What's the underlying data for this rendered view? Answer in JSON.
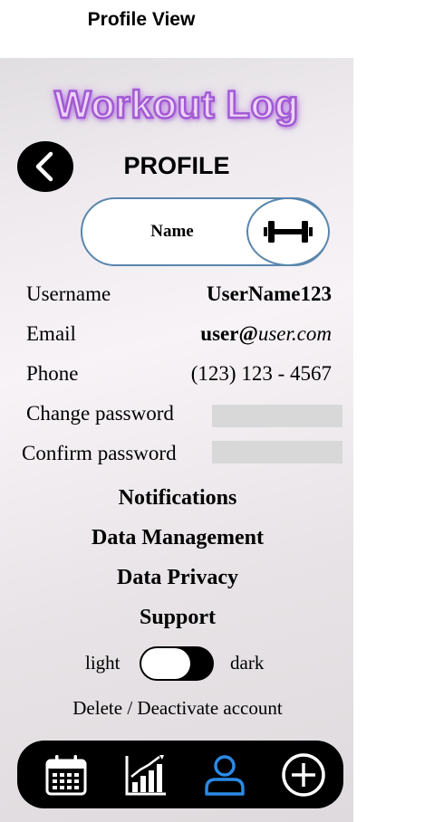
{
  "caption": "Profile View",
  "app": {
    "title": "Workout Log"
  },
  "header": {
    "title": "PROFILE",
    "back_icon": "chevron-left-icon"
  },
  "profile": {
    "name": "Name",
    "avatar_icon": "dumbbell-icon"
  },
  "fields": {
    "username": {
      "label": "Username",
      "value": "UserName123"
    },
    "email": {
      "label": "Email",
      "value_user": "user@",
      "value_domain": "user.com"
    },
    "phone": {
      "label": "Phone",
      "value": "(123) 123 - 4567"
    },
    "change_password": {
      "label": "Change password",
      "value": ""
    },
    "confirm_password": {
      "label": "Confirm password",
      "value": ""
    }
  },
  "menu": {
    "notifications": "Notifications",
    "data_management": "Data Management",
    "data_privacy": "Data Privacy",
    "support": "Support"
  },
  "theme": {
    "light_label": "light",
    "dark_label": "dark",
    "state": "light"
  },
  "account": {
    "delete_label": "Delete / Deactivate account"
  },
  "nav": {
    "items": [
      {
        "icon": "calendar-icon",
        "active": false
      },
      {
        "icon": "bar-chart-icon",
        "active": false
      },
      {
        "icon": "profile-icon",
        "active": true
      },
      {
        "icon": "add-circle-icon",
        "active": false
      }
    ],
    "active_color": "#2a8ae6",
    "inactive_color": "#ffffff"
  },
  "colors": {
    "title_fill": "#ecd5f5",
    "title_stroke": "#a25ad4",
    "pill_border": "#5a86ad",
    "input_bg": "#d8d8d8"
  }
}
